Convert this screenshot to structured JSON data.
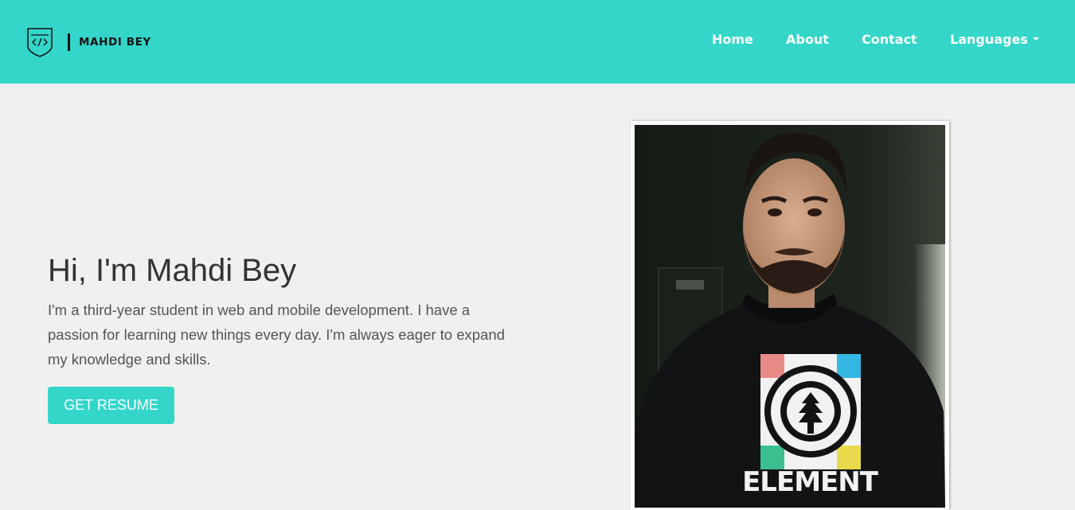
{
  "header": {
    "brand_name": "MAHDI BEY",
    "logo_icon": "code-shield-icon",
    "nav": {
      "home": "Home",
      "about": "About",
      "contact": "Contact",
      "languages": "Languages"
    }
  },
  "hero": {
    "title": "Hi, I'm Mahdi Bey",
    "description": "I'm a third-year student in web and mobile development. I have a passion for learning new things every day. I'm always eager to expand my knowledge and skills.",
    "button_label": "GET RESUME",
    "photo_alt": "Mahdi Bey",
    "shirt_text": "ELEMENT"
  },
  "colors": {
    "accent": "#33d6c9",
    "background": "#f0f0f0",
    "heading": "#333333",
    "body_text": "#555555"
  }
}
